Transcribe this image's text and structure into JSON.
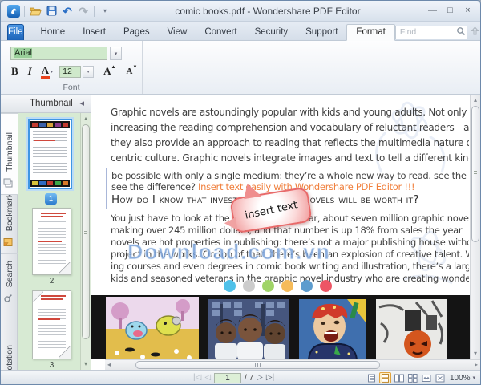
{
  "titlebar": {
    "title": "comic books.pdf - Wondershare PDF Editor",
    "undo_glyph": "↶",
    "redo_glyph": "↷",
    "more_glyph": "▾",
    "minimize_glyph": "—",
    "maximize_glyph": "□",
    "close_glyph": "×"
  },
  "tabs": {
    "file": "File",
    "items": [
      "Home",
      "Insert",
      "Pages",
      "View",
      "Convert",
      "Security",
      "Support",
      "Format"
    ],
    "active": "Format"
  },
  "find": {
    "placeholder": "Find"
  },
  "ribbon": {
    "font": {
      "family": "Arial",
      "size": "12",
      "bold": "B",
      "italic": "I",
      "color_letter": "A",
      "grow_letter": "A",
      "shrink_letter": "A",
      "group_label": "Font",
      "dropdown_glyph": "▾"
    }
  },
  "sidebar": {
    "header": "Thumbnail",
    "collapse_glyph": "◂",
    "tabs": [
      "Thumbnail",
      "Bookmark",
      "Search",
      "Annotation"
    ],
    "pages": [
      "1",
      "2",
      "3"
    ],
    "scroll_up_glyph": "▴",
    "scroll_down_glyph": "▾"
  },
  "document": {
    "para1": [
      "Graphic novels are astoundingly popular with kids and young adults.  Not only",
      "increasing the reading comprehension and vocabulary of reluctant readers—and e",
      "they also provide an approach to reading that reflects the multimedia nature of to",
      "centric culture.  Graphic novels integrate images and text to tell a different kind o"
    ],
    "boxed": {
      "line1": "be possible with only a single medium: they’re a whole new way to read. see the",
      "line2_black": "see the difference? ",
      "line2_orange": "Insert text easily with Wondershare PDF Editor !!!",
      "heading": "How do I know that investing in graphic novels will be worth it?"
    },
    "para2": [
      "You just have to look at the numbers.  Last year, about seven million graphic novels changed",
      "making over 245 million dollars, and that number is up 18% from sales the year",
      "novels are hot properties in publishing: there’s not a major publishing house witho",
      "project in the works.  On top of that, there’s been an explosion of creative talent.  W",
      "ing courses and even degrees in comic book writing and illustration, there’s a larg",
      "kids and seasoned veterans in the graphic novel industry who are creating wonde"
    ],
    "balloon_text": "insert text",
    "watermark": "Download.com.vn",
    "dot_colors": [
      "#4fc1e9",
      "#cccccc",
      "#a0d468",
      "#f6bb5a",
      "#5d9cce",
      "#ed5565"
    ]
  },
  "statusbar": {
    "first_glyph": "◁",
    "prev_glyph": "◁",
    "next_glyph": "▷",
    "last_glyph": "▷",
    "page": "1",
    "page_total": "/ 7",
    "zoom": "100%",
    "zoom_caret": "▾"
  }
}
